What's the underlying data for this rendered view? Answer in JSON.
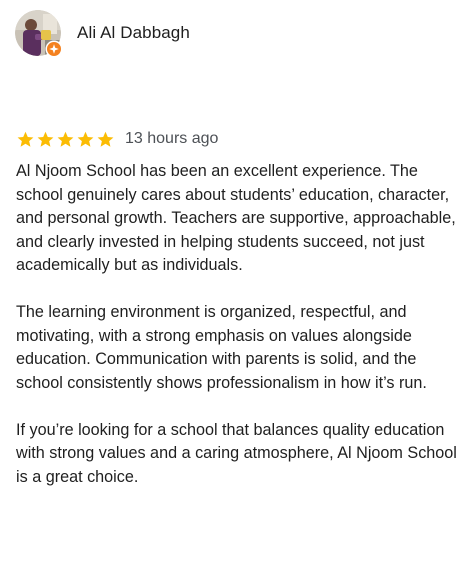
{
  "reviewer": {
    "name": "Ali Al Dabbagh",
    "badge_icon": "local-guide-badge-icon",
    "badge_color": "#f4811f"
  },
  "review": {
    "rating": 5,
    "rating_max": 5,
    "star_color": "#fbbc04",
    "time": "13 hours ago",
    "paragraphs": [
      "Al Njoom School has been an excellent experience. The school genuinely cares about students’ education, character, and personal growth. Teachers are supportive, approachable, and clearly invested in helping students succeed, not just academically but as individuals.",
      "The learning environment is organized, respectful, and motivating, with a strong emphasis on values alongside education. Communication with parents is solid, and the school consistently shows professionalism in how it’s run.",
      "If you’re looking for a school that balances quality education with strong values and a caring atmosphere, Al Njoom School is a great choice."
    ]
  }
}
